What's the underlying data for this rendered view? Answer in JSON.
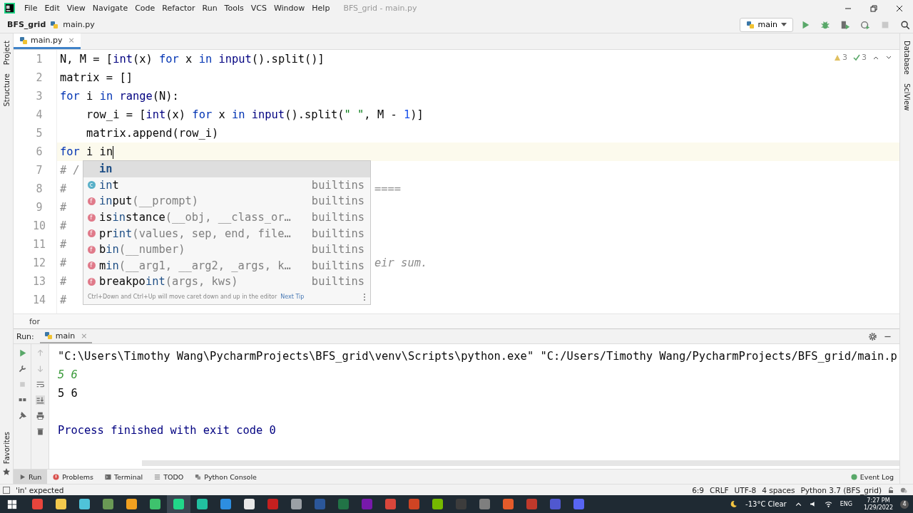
{
  "menu": [
    "File",
    "Edit",
    "View",
    "Navigate",
    "Code",
    "Refactor",
    "Run",
    "Tools",
    "VCS",
    "Window",
    "Help"
  ],
  "window": {
    "title": "BFS_grid - main.py"
  },
  "breadcrumb": {
    "project": "BFS_grid",
    "file": "main.py"
  },
  "run_config": {
    "label": "main"
  },
  "left_tools": [
    "Project",
    "Structure"
  ],
  "left_bottom_tool": "Favorites",
  "right_tools": [
    "Database",
    "SciView"
  ],
  "editor_tabs": [
    {
      "label": "main.py",
      "close": "×",
      "selected": true
    }
  ],
  "inspections": {
    "warnings": "3",
    "typos": "3"
  },
  "code_lines": [
    {
      "number": "1",
      "current": false,
      "segments": [
        {
          "t": "N, M = [",
          "kind": "plain"
        },
        {
          "t": "int",
          "kind": "builtin"
        },
        {
          "t": "(x) ",
          "kind": "plain"
        },
        {
          "t": "for",
          "kind": "kw"
        },
        {
          "t": " x ",
          "kind": "plain"
        },
        {
          "t": "in",
          "kind": "kw"
        },
        {
          "t": " input",
          "kind": "builtin"
        },
        {
          "t": "().split()]",
          "kind": "plain"
        }
      ]
    },
    {
      "number": "2",
      "current": false,
      "segments": [
        {
          "t": "matrix = []",
          "kind": "plain"
        }
      ]
    },
    {
      "number": "3",
      "current": false,
      "segments": [
        {
          "t": "for",
          "kind": "kw"
        },
        {
          "t": " i ",
          "kind": "plain"
        },
        {
          "t": "in",
          "kind": "kw"
        },
        {
          "t": " range",
          "kind": "builtin"
        },
        {
          "t": "(N):",
          "kind": "plain"
        }
      ]
    },
    {
      "number": "4",
      "current": false,
      "segments": [
        {
          "t": "    row_i = [",
          "kind": "plain"
        },
        {
          "t": "int",
          "kind": "builtin"
        },
        {
          "t": "(x) ",
          "kind": "plain"
        },
        {
          "t": "for",
          "kind": "kw"
        },
        {
          "t": " x ",
          "kind": "plain"
        },
        {
          "t": "in",
          "kind": "kw"
        },
        {
          "t": " input",
          "kind": "builtin"
        },
        {
          "t": "().split(",
          "kind": "plain"
        },
        {
          "t": "\" \"",
          "kind": "str"
        },
        {
          "t": ", M - ",
          "kind": "plain"
        },
        {
          "t": "1",
          "kind": "num"
        },
        {
          "t": ")]",
          "kind": "plain"
        }
      ]
    },
    {
      "number": "5",
      "current": false,
      "segments": [
        {
          "t": "    matrix.append(row_i)",
          "kind": "plain"
        }
      ]
    },
    {
      "number": "6",
      "current": true,
      "segments": [
        {
          "t": "for",
          "kind": "kw"
        },
        {
          "t": " i in",
          "kind": "plain"
        }
      ]
    },
    {
      "number": "7",
      "current": false,
      "segments": [
        {
          "t": "# /",
          "kind": "comment"
        }
      ]
    },
    {
      "number": "8",
      "current": false,
      "segments": [
        {
          "t": "#",
          "kind": "comment"
        }
      ],
      "tail": "===="
    },
    {
      "number": "9",
      "current": false,
      "segments": [
        {
          "t": "#",
          "kind": "comment"
        }
      ]
    },
    {
      "number": "10",
      "current": false,
      "segments": [
        {
          "t": "#",
          "kind": "comment"
        }
      ]
    },
    {
      "number": "11",
      "current": false,
      "segments": [
        {
          "t": "#",
          "kind": "comment"
        }
      ]
    },
    {
      "number": "12",
      "current": false,
      "segments": [
        {
          "t": "#",
          "kind": "comment"
        }
      ],
      "tail": "eir sum."
    },
    {
      "number": "13",
      "current": false,
      "segments": [
        {
          "t": "#",
          "kind": "comment"
        }
      ]
    },
    {
      "number": "14",
      "current": false,
      "segments": [
        {
          "t": "#",
          "kind": "comment"
        }
      ]
    }
  ],
  "completion": {
    "items": [
      {
        "kind": "keyword",
        "selected": true,
        "name": [
          {
            "t": "in",
            "match": true
          }
        ]
      },
      {
        "kind": "class",
        "icon": "c",
        "selected": false,
        "name": [
          {
            "t": "in",
            "match": true
          },
          {
            "t": "t",
            "match": false
          }
        ],
        "source": "builtins"
      },
      {
        "kind": "function",
        "icon": "f",
        "selected": false,
        "name": [
          {
            "t": "in",
            "match": true
          },
          {
            "t": "put",
            "match": false
          }
        ],
        "params": "(__prompt)",
        "source": "builtins"
      },
      {
        "kind": "function",
        "icon": "f",
        "selected": false,
        "name": [
          {
            "t": "is",
            "match": false
          },
          {
            "t": "in",
            "match": true
          },
          {
            "t": "stance",
            "match": false
          }
        ],
        "params": "(__obj, __class_or…",
        "source": "builtins"
      },
      {
        "kind": "function",
        "icon": "f",
        "selected": false,
        "name": [
          {
            "t": "pr",
            "match": false
          },
          {
            "t": "int",
            "match": true
          }
        ],
        "params": "(values, sep, end, file…",
        "source": "builtins"
      },
      {
        "kind": "function",
        "icon": "f",
        "selected": false,
        "name": [
          {
            "t": "b",
            "match": false
          },
          {
            "t": "in",
            "match": true
          }
        ],
        "params": "(__number)",
        "source": "builtins"
      },
      {
        "kind": "function",
        "icon": "f",
        "selected": false,
        "name": [
          {
            "t": "m",
            "match": false
          },
          {
            "t": "in",
            "match": true
          }
        ],
        "params": "(__arg1, __arg2, _args, k…",
        "source": "builtins"
      },
      {
        "kind": "function",
        "icon": "f",
        "selected": false,
        "name": [
          {
            "t": "breakpo",
            "match": false
          },
          {
            "t": "int",
            "match": true
          }
        ],
        "params": "(args, kws)",
        "source": "builtins"
      }
    ],
    "hint": "Ctrl+Down and Ctrl+Up will move caret down and up in the editor",
    "next_tip": "Next Tip"
  },
  "editor_breadcrumb": "for",
  "run_panel": {
    "label": "Run:",
    "tab": "main",
    "tab_close": "×",
    "lines": [
      {
        "kind": "command",
        "text": "\"C:\\Users\\Timothy Wang\\PycharmProjects\\BFS_grid\\venv\\Scripts\\python.exe\" \"C:/Users/Timothy Wang/PycharmProjects/BFS_grid/main.p"
      },
      {
        "kind": "input",
        "text": "5 6"
      },
      {
        "kind": "output",
        "text": "5 6"
      },
      {
        "kind": "blank"
      },
      {
        "kind": "system",
        "text": "Process finished with exit code 0"
      }
    ]
  },
  "tool_tabs": [
    {
      "label": "Run",
      "selected": true
    },
    {
      "label": "Problems",
      "selected": false
    },
    {
      "label": "Terminal",
      "selected": false
    },
    {
      "label": "TODO",
      "selected": false
    },
    {
      "label": "Python Console",
      "selected": false
    }
  ],
  "event_log": "Event Log",
  "status_bar": {
    "message": "'in' expected",
    "items": [
      "6:9",
      "CRLF",
      "UTF-8",
      "4 spaces",
      "Python 3.7 (BFS_grid)"
    ]
  },
  "taskbar": {
    "apps": [
      {
        "color": "#e8453c",
        "active": false
      },
      {
        "color": "#f3c94d",
        "active": false
      },
      {
        "color": "#4fc3d9",
        "active": false
      },
      {
        "color": "#6a9955",
        "active": false
      },
      {
        "color": "#f0a020",
        "active": false
      },
      {
        "color": "#3ec26d",
        "active": false
      },
      {
        "color": "#21d789",
        "active": true
      },
      {
        "color": "#21c0a0",
        "active": false
      },
      {
        "color": "#2d8ee0",
        "active": false
      },
      {
        "color": "#e8e8e8",
        "active": false
      },
      {
        "color": "#c5201f",
        "active": false
      },
      {
        "color": "#9aa0a6",
        "active": false
      },
      {
        "color": "#2b579a",
        "active": false
      },
      {
        "color": "#217346",
        "active": false
      },
      {
        "color": "#7719aa",
        "active": false
      },
      {
        "color": "#d9463b",
        "active": false
      },
      {
        "color": "#d04423",
        "active": false
      },
      {
        "color": "#76b900",
        "active": false
      },
      {
        "color": "#3c3c3c",
        "active": false
      },
      {
        "color": "#7f7f7f",
        "active": false
      },
      {
        "color": "#e55b2a",
        "active": false
      },
      {
        "color": "#c0392b",
        "active": false
      },
      {
        "color": "#5058d0",
        "active": false
      },
      {
        "color": "#5865f2",
        "active": false
      }
    ],
    "weather": "-13°C  Clear",
    "language": "ENG",
    "time": "7:27 PM",
    "date": "1/29/2022",
    "notifications": "4"
  }
}
